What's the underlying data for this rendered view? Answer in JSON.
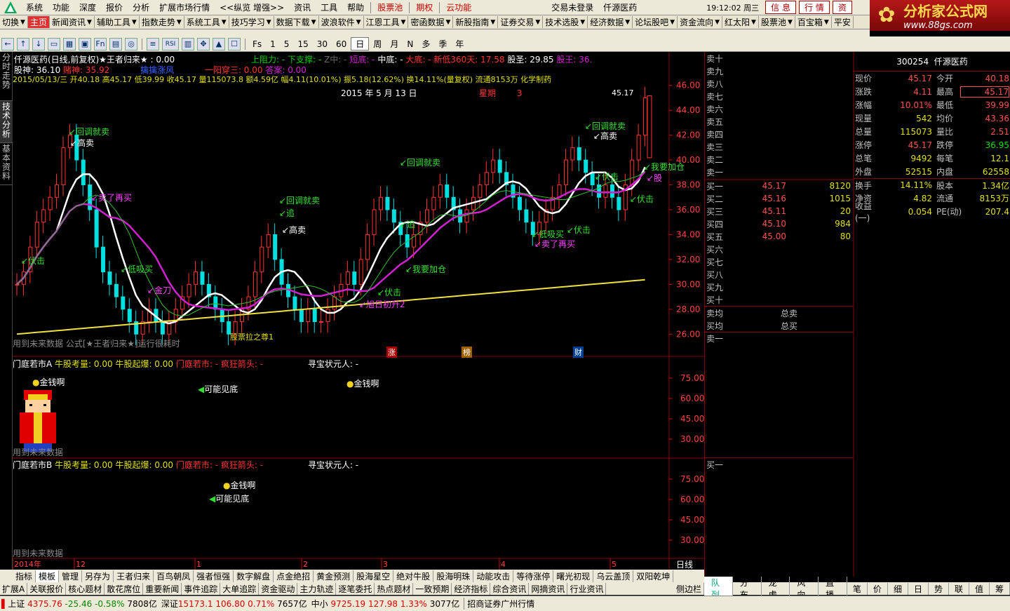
{
  "menu": {
    "items": [
      "系统",
      "功能",
      "深度",
      "报价",
      "分析",
      "扩展市场行情",
      "<<纵览 增强>>",
      "资讯",
      "工具",
      "帮助"
    ],
    "red_items": [
      "股票池",
      "期权",
      "云功能"
    ],
    "login": "交易未登录",
    "stock": "仟源医药",
    "time": "19:12:02 周三",
    "buttons": [
      "信 息",
      "行 情",
      "资"
    ]
  },
  "brand": {
    "title": "分析家公式网",
    "url": "www.88gs.com"
  },
  "toolbar1": [
    "切换",
    "主页",
    "新闻资讯",
    "辅助工具",
    "指数走势",
    "系统工具",
    "技巧学习",
    "数据下载",
    "波浪软件",
    "江恩工具",
    "密函数据",
    "新股指南",
    "证券交易",
    "技术选股",
    "经济数据",
    "论坛股吧",
    "资金流向",
    "红太阳",
    "股票池",
    "百宝箱",
    "平安"
  ],
  "toolbar2": {
    "icons": [
      "←",
      "↑",
      "↓",
      "▭",
      "▦",
      "▣",
      "Fn",
      "▤",
      "◎",
      "≡",
      "RSI",
      "▥",
      "✥",
      "▲",
      "☐"
    ],
    "periods": [
      "Fs",
      "1",
      "5",
      "15",
      "30",
      "60",
      "日",
      "周",
      "月",
      "N",
      "多",
      "季",
      "年"
    ],
    "selected_period": "日"
  },
  "leftbar": [
    "分时走势",
    "技术分析",
    "基本资料"
  ],
  "chart": {
    "title_line1": "仟源医药(日线,前复权)★王者归来★ : 0.00",
    "info1": {
      "resist": "上阻力: -",
      "support": "下支撑: -",
      "zz": "Z中: -",
      "short": "短底: -",
      "mid": "中底: -",
      "big": "大底: -",
      "new360": "新低360天: 17.58",
      "saint": "股圣: 29.85",
      "king": "股王: 36."
    },
    "info2": {
      "gn": "股神: 36.10",
      "gs": "股神: 35.92",
      "ds": "赌神: 35.92",
      "pp": "擒擒涨风",
      "yy": "一阳穿三: 0.00",
      "da": "答案: 0.00"
    },
    "ohlc": "2015/05/13/三 开40.18 高45.17 低39.99 收45.17 量115073.8 额4.59亿 幅4.11(10.01%) 振5.18(12.62%) 换14.11%(量复权) 流通8153万 化学制药",
    "date_label": "2015 年 5 月 13 日",
    "week_label": "星期",
    "week_num": "3",
    "last_price": "45.17",
    "price_axis": [
      "46.00",
      "44.00",
      "42.00",
      "40.00",
      "38.00",
      "36.00",
      "34.00",
      "32.00",
      "30.00",
      "28.00",
      "26.00"
    ],
    "price_range": [
      25,
      47
    ],
    "annotations": [
      "回调就卖",
      "高卖",
      "卖了再买",
      "伏击",
      "低吸买",
      "金刀",
      "回调就卖",
      "追",
      "高卖",
      "回调就卖",
      "追",
      "我要加仓",
      "旭日初升2",
      "伏击",
      "回调就卖",
      "高卖",
      "伏击",
      "低吸买",
      "卖了再买",
      "伏击",
      "伏击",
      "我要加仓",
      "股"
    ],
    "footer_note": "用到未来数据 公式[★王者归来★]运行很耗时",
    "ext_note": "股票拉之尊1",
    "events": [
      "涨",
      "榜",
      "财"
    ]
  },
  "sub1": {
    "title": "门庭若市A",
    "items": [
      "牛股考量: 0.00",
      "牛股起爆: 0.00",
      "门庭若市: -",
      "疯狂箭头: -",
      "寻宝状元人: -"
    ],
    "axis": [
      "75.00",
      "60.00",
      "45.00",
      "30.00"
    ],
    "labels": [
      "金钱啊",
      "可能见底",
      "金钱啊"
    ],
    "note": "用到未来数据"
  },
  "sub2": {
    "title": "门庭若市B",
    "items": [
      "牛股考量: 0.00",
      "牛股起爆: 0.00",
      "门庭若市: -",
      "疯狂箭头: -",
      "寻宝状元人: -"
    ],
    "axis": [
      "75.00",
      "60.00",
      "45.00",
      "30.00"
    ],
    "labels": [
      "金钱啊",
      "可能见底"
    ],
    "note": "用到未来数据"
  },
  "timeaxis": {
    "labels": [
      "2014年",
      "12",
      "1",
      "2",
      "3",
      "4",
      "5"
    ],
    "period": "日线"
  },
  "orderbook": {
    "sell": [
      "卖十",
      "卖九",
      "卖八",
      "卖七",
      "卖六",
      "卖五",
      "卖四",
      "卖三",
      "卖二",
      "卖一"
    ],
    "buy": [
      {
        "label": "买一",
        "price": "45.17",
        "vol": "8120"
      },
      {
        "label": "买二",
        "price": "45.16",
        "vol": "1015"
      },
      {
        "label": "买三",
        "price": "45.11",
        "vol": "20"
      },
      {
        "label": "买四",
        "price": "45.10",
        "vol": "984"
      },
      {
        "label": "买五",
        "price": "45.00",
        "vol": "80"
      },
      {
        "label": "买六",
        "price": "",
        "vol": ""
      },
      {
        "label": "买七",
        "price": "",
        "vol": ""
      },
      {
        "label": "买八",
        "price": "",
        "vol": ""
      },
      {
        "label": "买九",
        "price": "",
        "vol": ""
      },
      {
        "label": "买十",
        "price": "",
        "vol": ""
      }
    ],
    "avg_sell": "卖均",
    "total_sell": "总卖",
    "avg_buy": "买均",
    "total_buy": "总买",
    "sell1b": "卖一",
    "buy1b": "买一"
  },
  "quote": {
    "code": "300254",
    "name": "仟源医药",
    "rows": [
      {
        "k": "现价",
        "v": "45.17",
        "k2": "今开",
        "v2": "40.18"
      },
      {
        "k": "涨跌",
        "v": "4.11",
        "k2": "最高",
        "v2": "45.17"
      },
      {
        "k": "涨幅",
        "v": "10.01%",
        "k2": "最低",
        "v2": "39.99"
      },
      {
        "k": "现量",
        "v": "542",
        "k2": "均价",
        "v2": "43.36"
      },
      {
        "k": "总量",
        "v": "115073",
        "k2": "量比",
        "v2": "2.51"
      },
      {
        "k": "涨停",
        "v": "45.17",
        "k2": "跌停",
        "v2": "36.95"
      },
      {
        "k": "总笔",
        "v": "9492",
        "k2": "每笔",
        "v2": "12.1"
      },
      {
        "k": "外盘",
        "v": "52515",
        "k2": "内盘",
        "v2": "62558"
      },
      {
        "k": "换手",
        "v": "14.11%",
        "k2": "股本",
        "v2": "1.34亿"
      },
      {
        "k": "净资",
        "v": "4.82",
        "k2": "流通",
        "v2": "8153万"
      },
      {
        "k": "收益(一)",
        "v": "0.054",
        "k2": "PE(动)",
        "v2": "207.4"
      }
    ]
  },
  "bottomtabs": [
    "指标",
    "模板",
    "管理",
    "另存为",
    "王者归来",
    "百鸟朝凤",
    "强者恒强",
    "数字解盘",
    "点金绝招",
    "黄金预测",
    "股海星空",
    "绝对牛股",
    "股海明珠",
    "动能攻击",
    "等待涨停",
    "曙光初现",
    "乌云盖顶",
    "双阳乾坤"
  ],
  "bottomtabs2": [
    "扩展A",
    "关联报价",
    "核心题材",
    "散花席位",
    "重要新闻",
    "事件追踪",
    "大单追踪",
    "资金驱动",
    "主力轨迹",
    "逐笔委托",
    "热点题材",
    "一致预期",
    "经济指标",
    "综合资讯",
    "网摘资讯",
    "行业资讯"
  ],
  "bottomtabs2_extra": "侧边栏",
  "rtabs": [
    "队列",
    "分布",
    "龙虎",
    "风向",
    "直播",
    "笔",
    "价",
    "细",
    "日",
    "势",
    "联",
    "值",
    "筹"
  ],
  "status": {
    "sh_label": "上证",
    "sh_val": "4375.76",
    "sh_chg": "-25.46",
    "sh_pct": "-0.58%",
    "sh_amt": "7808亿",
    "sz_label": "深证",
    "sz_val": "15173.1",
    "sz_chg": "106.80",
    "sz_pct": "0.71%",
    "sz_amt": "7657亿",
    "zx_label": "中小",
    "zx_val": "9725.19",
    "zx_chg": "127.98",
    "zx_pct": "1.33%",
    "zx_amt": "3077亿",
    "broker": "招商证券广州行情"
  },
  "colors": {
    "up": "#ff3333",
    "down": "#00e0e0",
    "ma_white": "#ffffff",
    "ma_magenta": "#d020d0",
    "ma_yellow": "#f0e040",
    "ma_green": "#30c030"
  }
}
